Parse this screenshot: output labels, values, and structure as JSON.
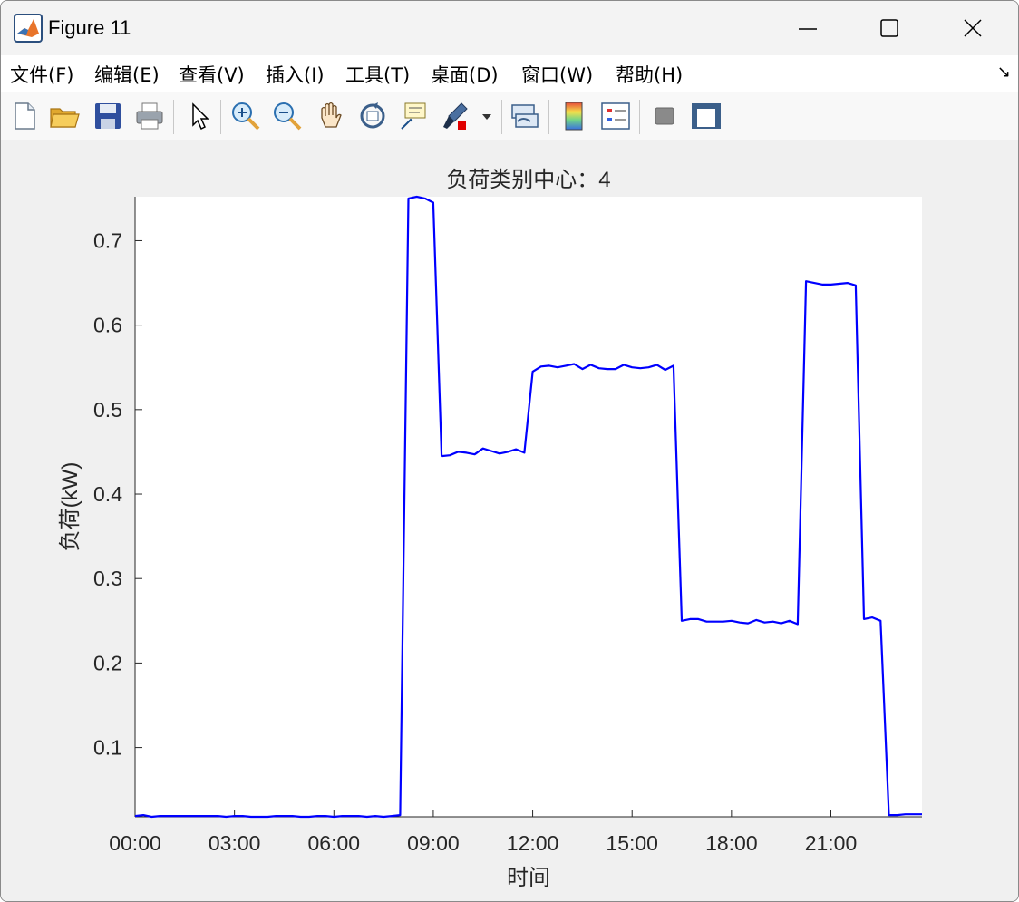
{
  "window": {
    "title": "Figure 11"
  },
  "menu": {
    "items": [
      "文件(F)",
      "编辑(E)",
      "查看(V)",
      "插入(I)",
      "工具(T)",
      "桌面(D)",
      "窗口(W)",
      "帮助(H)"
    ]
  },
  "toolbar": {
    "icons": [
      "new-file-icon",
      "open-folder-icon",
      "save-icon",
      "print-icon",
      "pointer-icon",
      "zoom-in-icon",
      "zoom-out-icon",
      "pan-icon",
      "rotate-3d-icon",
      "data-cursor-icon",
      "brush-icon",
      "link-plot-icon",
      "colorbar-icon",
      "legend-icon",
      "hide-plot-tools-icon",
      "show-plot-tools-icon"
    ]
  },
  "chart_data": {
    "type": "line",
    "title": "负荷类别中心：4",
    "xlabel": "时间",
    "ylabel": "负荷(kW)",
    "x_ticks": [
      "00:00",
      "03:00",
      "06:00",
      "09:00",
      "12:00",
      "15:00",
      "18:00",
      "21:00"
    ],
    "y_ticks": [
      "0.1",
      "0.2",
      "0.3",
      "0.4",
      "0.5",
      "0.6",
      "0.7"
    ],
    "xlim_hours": [
      0,
      23.75
    ],
    "ylim": [
      0.018,
      0.752
    ],
    "line_color": "#0000ff",
    "grid": false,
    "series": [
      {
        "x_hours": [
          0,
          0.25,
          0.5,
          0.75,
          1,
          1.25,
          1.5,
          1.75,
          2,
          2.25,
          2.5,
          2.75,
          3,
          3.25,
          3.5,
          3.75,
          4,
          4.25,
          4.5,
          4.75,
          5,
          5.25,
          5.5,
          5.75,
          6,
          6.25,
          6.5,
          6.75,
          7,
          7.25,
          7.5,
          7.75,
          8,
          8.25,
          8.5,
          8.75,
          9,
          9.25,
          9.5,
          9.75,
          10,
          10.25,
          10.5,
          10.75,
          11,
          11.25,
          11.5,
          11.75,
          12,
          12.25,
          12.5,
          12.75,
          13,
          13.25,
          13.5,
          13.75,
          14,
          14.25,
          14.5,
          14.75,
          15,
          15.25,
          15.5,
          15.75,
          16,
          16.25,
          16.5,
          16.75,
          17,
          17.25,
          17.5,
          17.75,
          18,
          18.25,
          18.5,
          18.75,
          19,
          19.25,
          19.5,
          19.75,
          20,
          20.25,
          20.5,
          20.75,
          21,
          21.25,
          21.5,
          21.75,
          22,
          22.25,
          22.5,
          22.75,
          23,
          23.25,
          23.5,
          23.75
        ],
        "values": [
          0.019,
          0.02,
          0.018,
          0.019,
          0.019,
          0.019,
          0.019,
          0.019,
          0.019,
          0.019,
          0.019,
          0.018,
          0.019,
          0.019,
          0.018,
          0.018,
          0.018,
          0.019,
          0.019,
          0.019,
          0.018,
          0.018,
          0.019,
          0.019,
          0.018,
          0.019,
          0.019,
          0.019,
          0.018,
          0.019,
          0.018,
          0.019,
          0.02,
          0.75,
          0.752,
          0.75,
          0.745,
          0.445,
          0.446,
          0.45,
          0.449,
          0.447,
          0.454,
          0.451,
          0.448,
          0.45,
          0.453,
          0.449,
          0.545,
          0.551,
          0.552,
          0.55,
          0.552,
          0.554,
          0.548,
          0.553,
          0.549,
          0.548,
          0.548,
          0.553,
          0.55,
          0.549,
          0.55,
          0.553,
          0.547,
          0.552,
          0.25,
          0.252,
          0.252,
          0.249,
          0.249,
          0.249,
          0.25,
          0.248,
          0.247,
          0.251,
          0.248,
          0.249,
          0.247,
          0.25,
          0.246,
          0.652,
          0.65,
          0.648,
          0.648,
          0.649,
          0.65,
          0.647,
          0.252,
          0.254,
          0.25,
          0.02,
          0.02,
          0.021,
          0.021,
          0.021
        ]
      }
    ]
  }
}
